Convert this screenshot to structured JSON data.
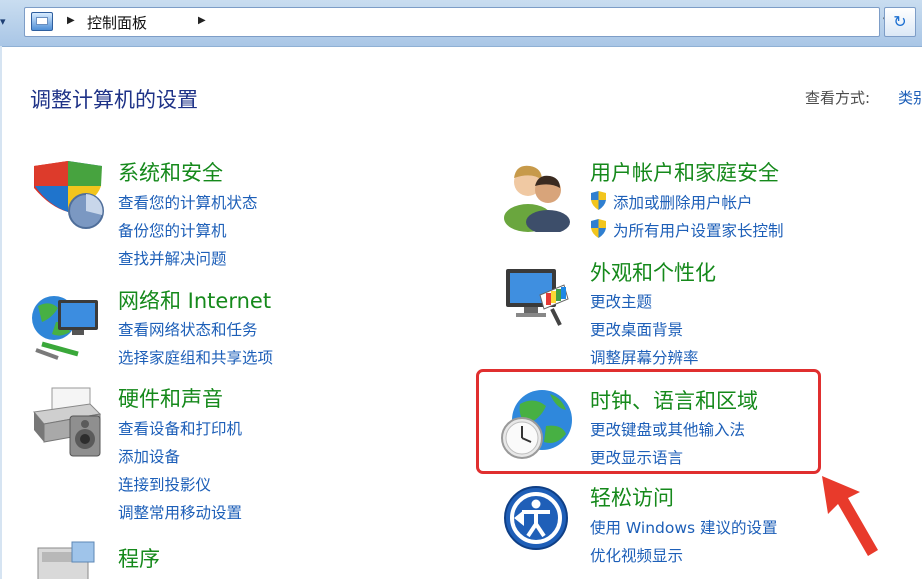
{
  "address_bar": {
    "breadcrumb": "控制面板"
  },
  "header": {
    "title": "调整计算机的设置",
    "view_by_label": "查看方式:",
    "view_by_value": "类别"
  },
  "categories": [
    {
      "title": "系统和安全",
      "icon": "shield-icon",
      "links": [
        "查看您的计算机状态",
        "备份您的计算机",
        "查找并解决问题"
      ]
    },
    {
      "title": "网络和 Internet",
      "icon": "network-icon",
      "links": [
        "查看网络状态和任务",
        "选择家庭组和共享选项"
      ]
    },
    {
      "title": "硬件和声音",
      "icon": "printer-icon",
      "links": [
        "查看设备和打印机",
        "添加设备",
        "连接到投影仪",
        "调整常用移动设置"
      ]
    },
    {
      "title": "程序",
      "icon": "programs-icon",
      "links": []
    },
    {
      "title": "用户帐户和家庭安全",
      "icon": "users-icon",
      "links": [
        "添加或删除用户帐户",
        "为所有用户设置家长控制"
      ]
    },
    {
      "title": "外观和个性化",
      "icon": "display-palette-icon",
      "links": [
        "更改主题",
        "更改桌面背景",
        "调整屏幕分辨率"
      ]
    },
    {
      "title": "时钟、语言和区域",
      "icon": "globe-clock-icon",
      "links": [
        "更改键盘或其他输入法",
        "更改显示语言"
      ]
    },
    {
      "title": "轻松访问",
      "icon": "ease-of-access-icon",
      "links": [
        "使用 Windows 建议的设置",
        "优化视频显示"
      ]
    }
  ],
  "colors": {
    "category_title": "#15891b",
    "link": "#1d5fb8",
    "page_title": "#1e3287",
    "highlight_box": "#e02f2f"
  }
}
